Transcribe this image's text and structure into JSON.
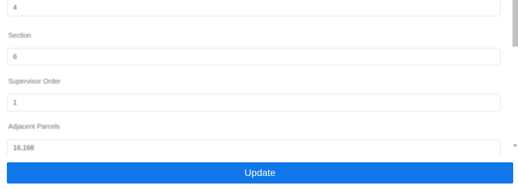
{
  "form": {
    "fields": [
      {
        "label": "",
        "value": "4"
      },
      {
        "label": "Section",
        "value": "6"
      },
      {
        "label": "Supervisor Order",
        "value": "1"
      },
      {
        "label": "Adjacent Parcels",
        "value": "16,168"
      }
    ]
  },
  "actions": {
    "update_label": "Update"
  },
  "colors": {
    "button": "#1176e8",
    "scroll_thumb": "#c1c1c1"
  }
}
